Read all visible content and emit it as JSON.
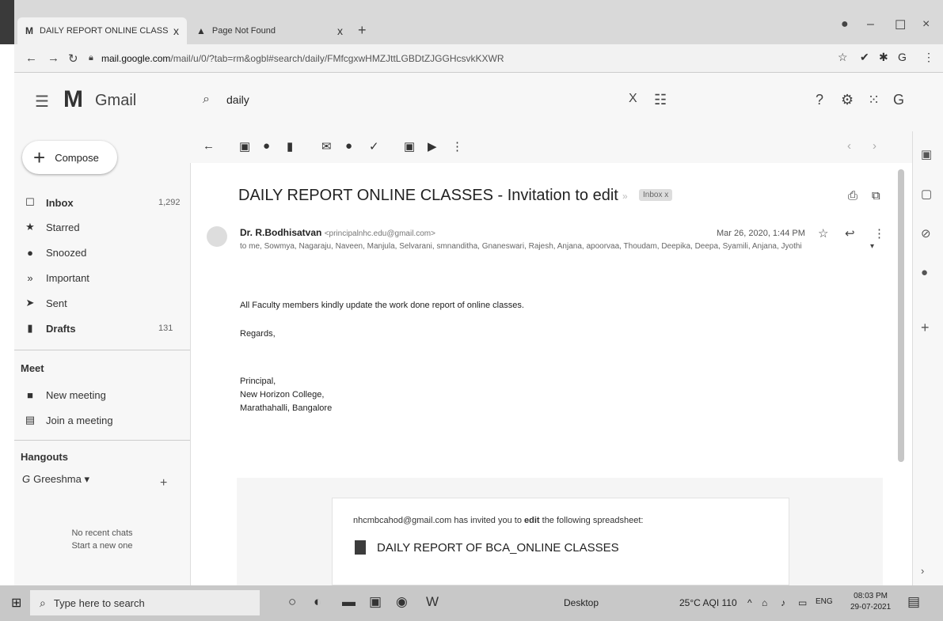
{
  "browser": {
    "tabs": [
      {
        "favicon": "M",
        "title": "DAILY REPORT ONLINE CLASSES",
        "close": "x"
      },
      {
        "favicon": "▲",
        "title": "Page Not Found",
        "close": "x"
      }
    ],
    "new_tab": "+",
    "url_domain": "mail.google.com",
    "url_path": "/mail/u/0/?tab=rm&ogbl#search/daily/FMfcgxwHMZJttLGBDtZJGGHcsvkKXWR",
    "window_controls": [
      "–",
      "☐",
      "×"
    ]
  },
  "gmail": {
    "logo_text": "Gmail",
    "search_value": "daily",
    "search_clear": "X",
    "compose_label": "Compose",
    "nav": [
      {
        "label": "Inbox",
        "count": "1,292",
        "bold": true
      },
      {
        "label": "Starred",
        "count": ""
      },
      {
        "label": "Snoozed",
        "count": ""
      },
      {
        "label": "Important",
        "count": ""
      },
      {
        "label": "Sent",
        "count": ""
      },
      {
        "label": "Drafts",
        "count": "131",
        "bold": true
      }
    ],
    "meet": {
      "title": "Meet",
      "items": [
        "New meeting",
        "Join a meeting"
      ]
    },
    "hangouts": {
      "title": "Hangouts",
      "user": "Greeshma",
      "no_chats": "No recent chats",
      "start_new": "Start a new one"
    },
    "message": {
      "subject": "DAILY REPORT ONLINE CLASSES - Invitation to edit",
      "badge": "Inbox x",
      "sender_name": "Dr. R.Bodhisatvan",
      "sender_email": "<principalnhc.edu@gmail.com>",
      "recipients": "to me, Sowmya, Nagaraju, Naveen, Manjula, Selvarani, smnanditha, Gnaneswari, Rajesh, Anjana, apoorvaa, Thoudam, Deepika, Deepa, Syamili, Anjana, Jyothi",
      "date": "Mar 26, 2020, 1:44 PM",
      "body": [
        "All Faculty members kindly update the work done report of online classes.",
        "Regards,",
        "Principal,",
        "New Horizon College,",
        "Marathahalli, Bangalore"
      ],
      "invite_sender": "nhcmbcahod@gmail.com",
      "invite_mid": " has invited you to ",
      "invite_action": "edit",
      "invite_end": " the following spreadsheet:",
      "sheet_name": "DAILY REPORT OF BCA_ONLINE CLASSES"
    }
  },
  "taskbar": {
    "search_placeholder": "Type here to search",
    "desktop": "Desktop",
    "weather": "25°C AQI 110",
    "lang": "ENG",
    "time": "08:03 PM",
    "date": "29-07-2021"
  }
}
